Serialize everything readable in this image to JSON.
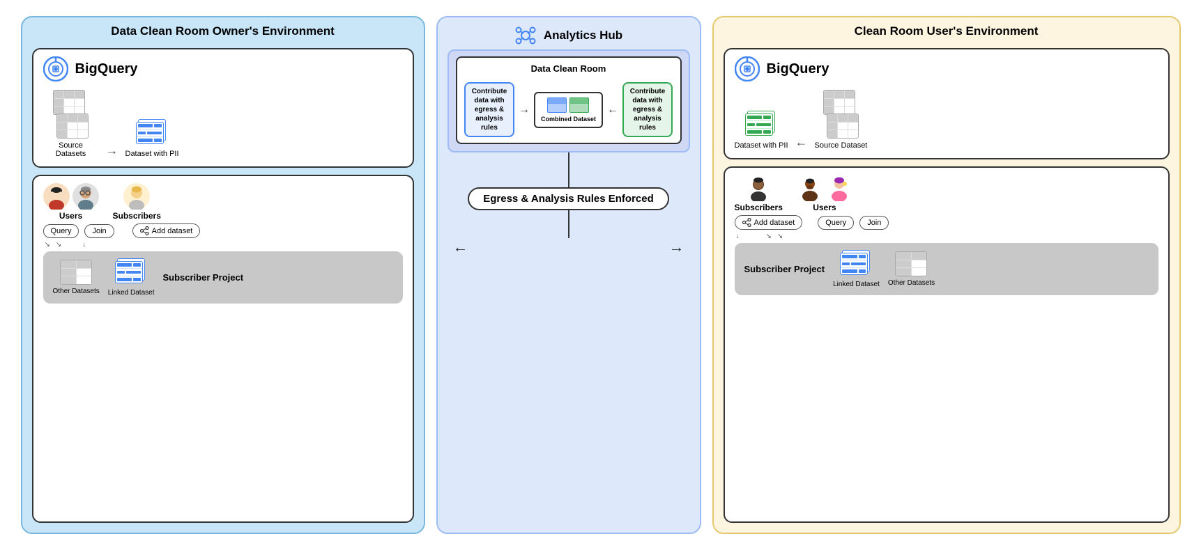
{
  "owner_env": {
    "title": "Data Clean Room Owner's Environment",
    "bq_label": "BigQuery",
    "source_datasets_label": "Source Datasets",
    "dataset_pii_label": "Dataset with PII",
    "users_label": "Users",
    "subscribers_label": "Subscribers",
    "query_btn": "Query",
    "join_btn": "Join",
    "add_dataset_btn": "Add dataset",
    "subscriber_project_label": "Subscriber Project",
    "other_datasets_label": "Other Datasets",
    "linked_dataset_label": "Linked Dataset"
  },
  "hub": {
    "title": "Analytics Hub",
    "dcr_title": "Data Clean Room",
    "contribute_label": "Contribute data with egress & analysis rules",
    "contribute_label_green": "Contribute data with egress & analysis rules",
    "combined_label": "Combined Dataset",
    "egress_label": "Egress & Analysis Rules Enforced"
  },
  "user_env": {
    "title": "Clean Room User's Environment",
    "bq_label": "BigQuery",
    "dataset_pii_label": "Dataset with PII",
    "source_dataset_label": "Source Dataset",
    "subscribers_label": "Subscribers",
    "users_label": "Users",
    "add_dataset_btn": "Add dataset",
    "query_btn": "Query",
    "join_btn": "Join",
    "subscriber_project_label": "Subscriber Project",
    "linked_dataset_label": "Linked Dataset",
    "other_datasets_label": "Other Datasets"
  }
}
